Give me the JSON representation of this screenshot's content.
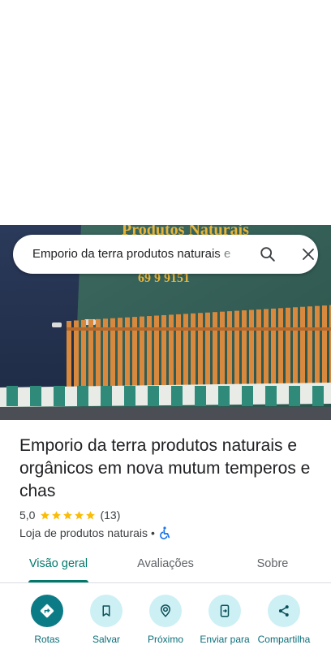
{
  "search": {
    "query": "Emporio da terra produtos naturais e"
  },
  "hero": {
    "sign_text": "Produtos Naturais",
    "phone_text": "69 9 9151"
  },
  "place": {
    "title": "Emporio da terra produtos naturais e orgânicos em nova mutum temperos e chas",
    "rating": "5,0",
    "stars": 5,
    "review_count": "(13)",
    "category": "Loja de produtos naturais",
    "separator": "•"
  },
  "tabs": [
    {
      "label": "Visão geral",
      "active": true
    },
    {
      "label": "Avaliações",
      "active": false
    },
    {
      "label": "Sobre",
      "active": false
    }
  ],
  "actions": [
    {
      "label": "Rotas",
      "icon": "directions-icon"
    },
    {
      "label": "Salvar",
      "icon": "bookmark-icon"
    },
    {
      "label": "Próximo",
      "icon": "nearby-icon"
    },
    {
      "label": "Enviar para",
      "icon": "send-to-phone-icon"
    },
    {
      "label": "Compartilha",
      "icon": "share-icon"
    }
  ],
  "colors": {
    "accent": "#00796b",
    "action_primary": "#0b7b86",
    "action_bg": "#cdf0f5",
    "star": "#fbbc04"
  }
}
